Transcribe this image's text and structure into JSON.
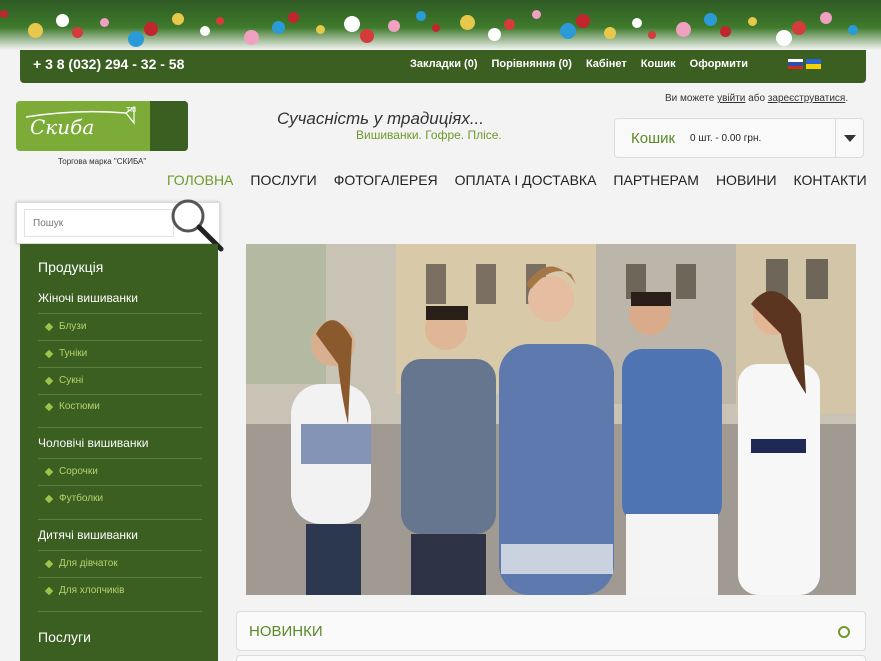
{
  "topbar": {
    "phone": "+ 3 8 (032) 294 - 32 - 58",
    "links": [
      "Закладки (0)",
      "Порівняння (0)",
      "Кабінет",
      "Кошик",
      "Оформити"
    ]
  },
  "header": {
    "logo_text": "Скиба",
    "logo_tm": "TM",
    "trademark": "Торгова марка \"СКИБА\"",
    "slogan": "Сучасність у традиціях...",
    "subslogan": "Вишиванки. Гофре. Плісе.",
    "login_prefix": "Ви можете",
    "login_link": "увійти",
    "login_mid": "або",
    "register_link": "зареєструватися",
    "login_suffix": "."
  },
  "cart": {
    "label": "Кошик",
    "info": "0 шт. - 0.00 грн."
  },
  "nav": {
    "items": [
      "ГОЛОВНА",
      "ПОСЛУГИ",
      "ФОТОГАЛЕРЕЯ",
      "ОПЛАТА І ДОСТАВКА",
      "ПАРТНЕРАМ",
      "НОВИНИ",
      "КОНТАКТИ"
    ]
  },
  "search": {
    "placeholder": "Пошук"
  },
  "sidebar": {
    "title": "Продукція",
    "categories": [
      {
        "name": "Жіночі вишиванки",
        "items": [
          "Блузи",
          "Туніки",
          "Сукні",
          "Костюми"
        ]
      },
      {
        "name": "Чоловічі вишиванки",
        "items": [
          "Сорочки",
          "Футболки"
        ]
      },
      {
        "name": "Дитячі вишиванки",
        "items": [
          "Для дівчаток",
          "Для хлопчиків"
        ]
      }
    ],
    "services_title": "Послуги"
  },
  "main": {
    "news_title": "НОВИНКИ"
  },
  "colors": {
    "brand_dark": "#3b5e21",
    "brand_light": "#7cab38",
    "accent_text": "#6e9a2c"
  }
}
